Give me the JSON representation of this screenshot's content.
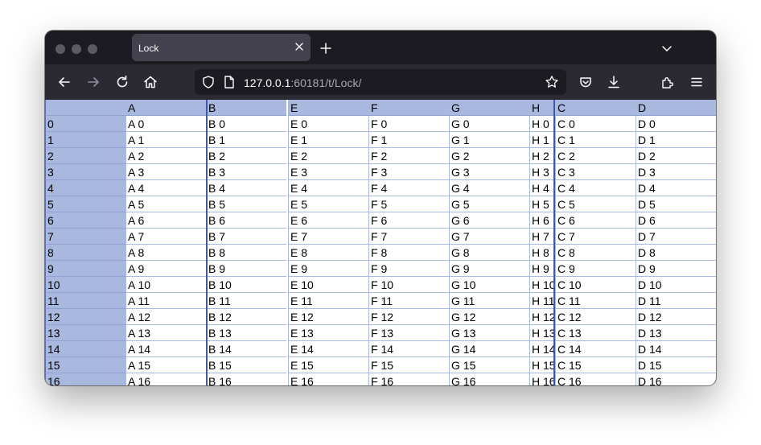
{
  "browser": {
    "tab_title": "Lock",
    "url_host": "127.0.0.1",
    "url_rest": ":60181/t/Lock/"
  },
  "grid": {
    "columns": [
      "A",
      "B",
      "E",
      "F",
      "G",
      "H",
      "C",
      "D"
    ],
    "row_count": 17
  },
  "colors": {
    "header_bg": "#a9b8df",
    "grid_line": "#a9b8df",
    "lock_divider": "#4058a5",
    "chrome_dark": "#1c1b22",
    "toolbar": "#2b2a33"
  }
}
